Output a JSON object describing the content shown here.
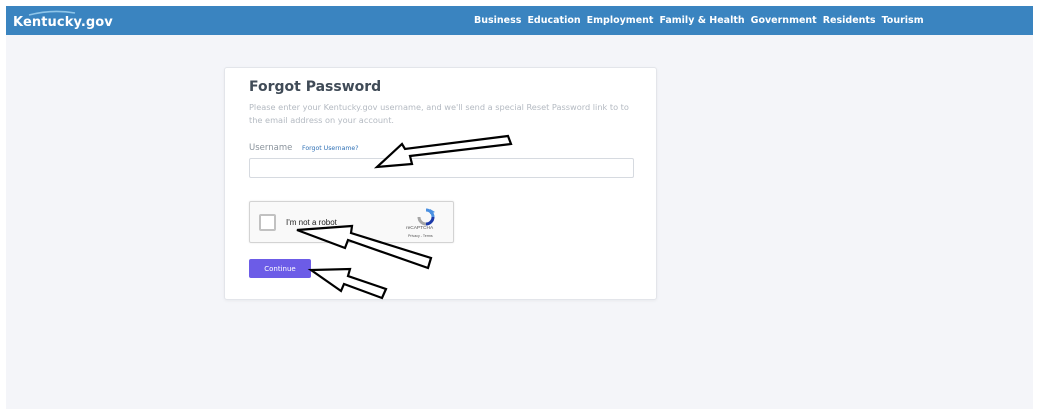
{
  "header": {
    "logo_text": "Kentucky.gov",
    "nav": [
      "Business",
      "Education",
      "Employment",
      "Family & Health",
      "Government",
      "Residents",
      "Tourism"
    ]
  },
  "form": {
    "title": "Forgot Password",
    "description": "Please enter your Kentucky.gov username, and we'll send a special Reset Password link to to the email address on your account.",
    "username_label": "Username",
    "forgot_username_link": "Forgot Username?",
    "username_value": "",
    "username_placeholder": "",
    "continue_label": "Continue"
  },
  "recaptcha": {
    "label": "I'm not a robot",
    "brand": "reCAPTCHA",
    "terms": "Privacy - Terms",
    "checked": false
  },
  "colors": {
    "header_bg": "#3a84c0",
    "page_bg": "#f4f5f9",
    "button_bg": "#6c5ce7",
    "link": "#2f70b5",
    "title": "#404b57"
  },
  "icons": [
    "recaptcha-logo-icon",
    "arrow-pointer-icon"
  ]
}
